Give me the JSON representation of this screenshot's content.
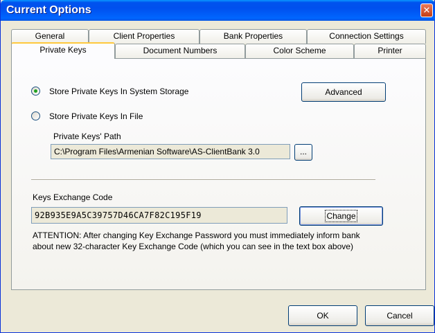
{
  "window": {
    "title": "Current Options",
    "close_glyph": "✕"
  },
  "tabs": {
    "row1": [
      "General",
      "Client Properties",
      "Bank Properties",
      "Connection Settings"
    ],
    "row2": [
      "Private Keys",
      "Document Numbers",
      "Color Scheme",
      "Printer"
    ],
    "active": "Private Keys"
  },
  "storage": {
    "option_system": "Store Private Keys In System Storage",
    "option_file": "Store Private Keys In File",
    "selected": "system",
    "path_label": "Private Keys' Path",
    "path_value": "C:\\Program Files\\Armenian Software\\AS-ClientBank 3.0",
    "browse_label": "...",
    "advanced_label": "Advanced"
  },
  "exchange": {
    "label": "Keys Exchange Code",
    "code": "92B935E9A5C39757D46CA7F82C195F19",
    "change_label": "Change",
    "attention_line1": "ATTENTION: After changing Key Exchange Password you must immediately inform bank",
    "attention_line2": "about new 32-character Key Exchange Code (which you can see in the text box above)"
  },
  "footer": {
    "ok_label": "OK",
    "cancel_label": "Cancel"
  },
  "colors": {
    "titlebar": "#0054e3",
    "active_tab_accent": "#ffc83c",
    "button_border": "#003c74"
  }
}
